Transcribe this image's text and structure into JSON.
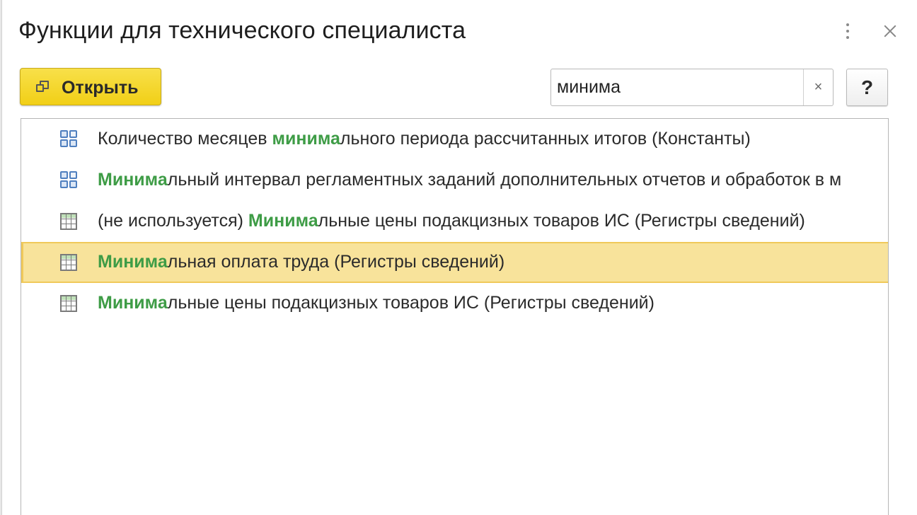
{
  "window": {
    "title": "Функции для технического специалиста"
  },
  "toolbar": {
    "open_label": "Открыть",
    "search_value": "минима",
    "clear_symbol": "×",
    "help_label": "?"
  },
  "icons": {
    "more": "more-vertical-icon",
    "close": "close-icon",
    "open": "open-window-icon",
    "constant": "constant-icon",
    "register": "info-register-icon"
  },
  "colors": {
    "highlight": "#3e9c46",
    "selection": "#f8e39b",
    "open_button": "#f4d62b"
  },
  "results": [
    {
      "icon": "constant-icon",
      "prefix": "Количество месяцев ",
      "match": "минима",
      "suffix": "льного периода рассчитанных итогов (Константы)",
      "selected": false
    },
    {
      "icon": "constant-icon",
      "prefix": "",
      "match": "Минима",
      "suffix": "льный интервал регламентных заданий дополнительных отчетов и обработок в м",
      "selected": false
    },
    {
      "icon": "info-register-icon",
      "prefix": "(не используется) ",
      "match": "Минима",
      "suffix": "льные цены подакцизных товаров ИС (Регистры сведений)",
      "selected": false
    },
    {
      "icon": "info-register-icon",
      "prefix": "",
      "match": "Минима",
      "suffix": "льная оплата труда (Регистры сведений)",
      "selected": true
    },
    {
      "icon": "info-register-icon",
      "prefix": "",
      "match": "Минима",
      "suffix": "льные цены подакцизных товаров ИС (Регистры сведений)",
      "selected": false
    }
  ]
}
